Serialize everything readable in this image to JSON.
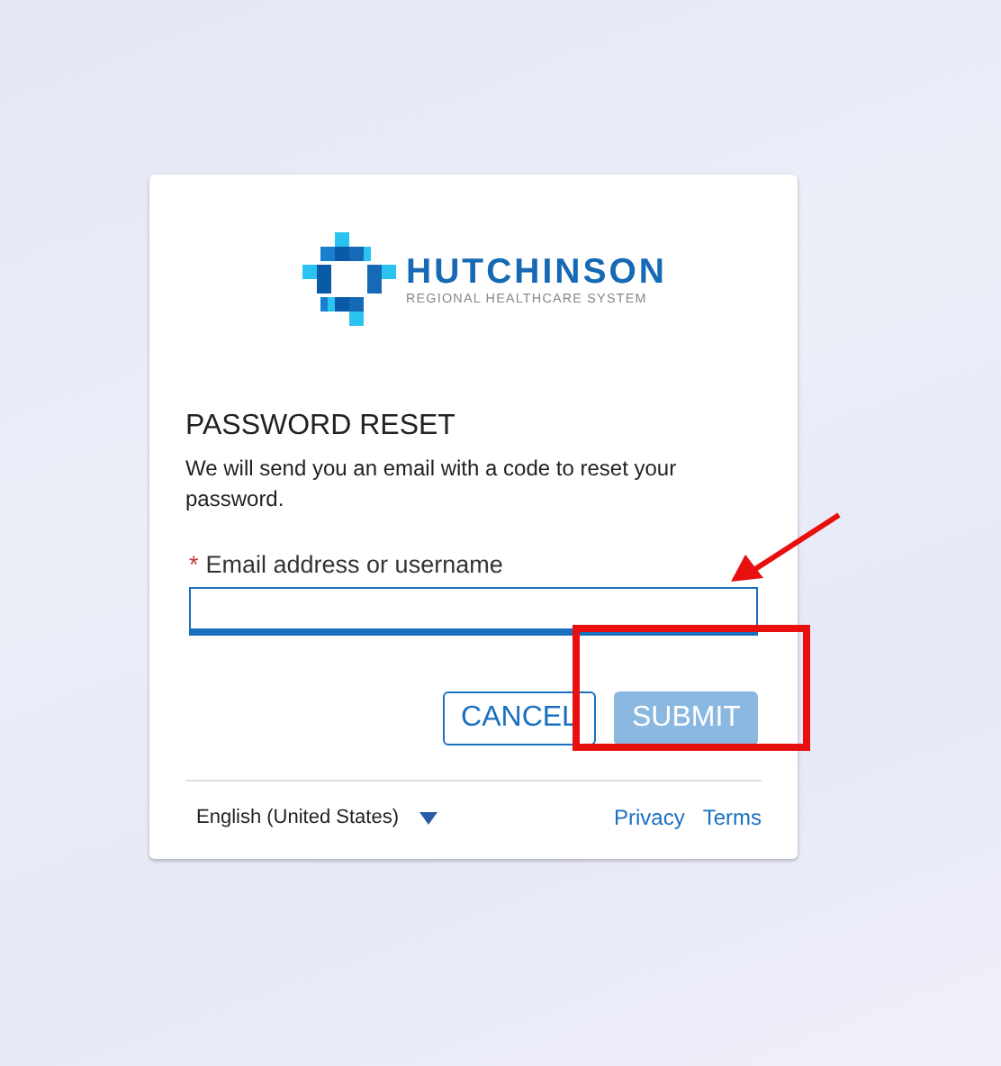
{
  "logo": {
    "name": "HUTCHINSON",
    "tagline": "REGIONAL HEALTHCARE SYSTEM"
  },
  "heading": "PASSWORD RESET",
  "description": "We will send you an email with a code to reset your password.",
  "field": {
    "label": "Email address or username",
    "required": true,
    "required_mark": "*",
    "focused": true
  },
  "buttons": [
    {
      "label": "CANCEL",
      "kind": "secondary",
      "disabled": false
    },
    {
      "label": "SUBMIT",
      "kind": "primary",
      "disabled": true
    }
  ],
  "footer": {
    "language": "English (United States)",
    "links": [
      "Privacy",
      "Terms"
    ]
  },
  "annotations": {
    "arrow": true,
    "box": true
  }
}
